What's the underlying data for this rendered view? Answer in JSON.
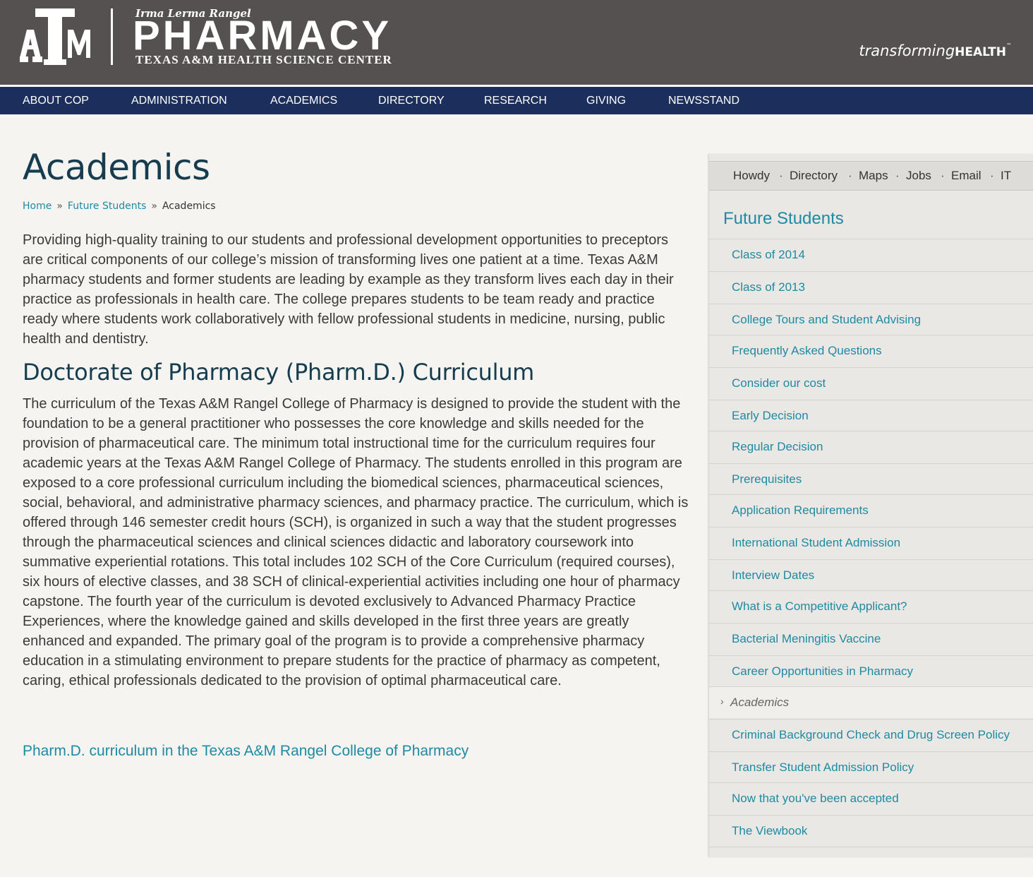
{
  "header": {
    "logo_sub": "Irma Lerma Rangel",
    "logo_main": "PHARMACY",
    "logo_center": "TEXAS A&M HEALTH SCIENCE CENTER",
    "logo_mark": "ATM",
    "tagline_part1": "transforming",
    "tagline_part2": "HEALTH",
    "tagline_tm": "™"
  },
  "nav": {
    "items": [
      "ABOUT COP",
      "ADMINISTRATION",
      "ACADEMICS",
      "DIRECTORY",
      "RESEARCH",
      "GIVING",
      "NEWSSTAND"
    ]
  },
  "main": {
    "title": "Academics",
    "breadcrumb": {
      "home": "Home",
      "sep": "»",
      "future": "Future Students",
      "current": "Academics"
    },
    "intro": "Providing high-quality training to our students and professional development opportunities to preceptors are critical components of our college’s mission of transforming lives one patient at a time. Texas A&M pharmacy students and former students are leading by example as they transform lives each day in their practice as professionals in health care. The college prepares students to be team ready and practice ready where students work collaboratively with fellow professional students in medicine, nursing, public health and dentistry.",
    "section_heading": "Doctorate of Pharmacy (Pharm.D.) Curriculum",
    "curriculum": "The curriculum of the Texas A&M Rangel College of Pharmacy is designed to provide the student with the foundation to be a general practitioner who possesses the core knowledge and skills needed for the provision of pharmaceutical care. The minimum total instructional time for the curriculum requires four academic years at the Texas A&M Rangel College of Pharmacy. The students enrolled in this program are exposed to a core professional curriculum including the biomedical sciences, pharmaceutical sciences, social, behavioral, and administrative pharmacy sciences, and pharmacy practice. The curriculum, which is offered through 146 semester credit hours (SCH), is organized in such a way that the student progresses through the pharmaceutical sciences and clinical sciences didactic and laboratory coursework into summative experiential rotations. This total includes 102 SCH of the Core Curriculum (required courses), six hours of elective classes, and 38 SCH of clinical-experiential activities including one hour of pharmacy capstone. The fourth year of the curriculum is devoted exclusively to Advanced Pharmacy Practice Experiences, where the knowledge gained and skills developed in the first three years are greatly enhanced and expanded. The primary goal of the program is to provide a comprehensive pharmacy education in a stimulating environment to prepare students for the practice of pharmacy as competent, caring, ethical professionals dedicated to the provision of optimal pharmaceutical care.",
    "pharmd_link": "Pharm.D. curriculum in the Texas A&M Rangel College of Pharmacy"
  },
  "sidebar": {
    "utility": {
      "links": [
        "Howdy",
        "Directory",
        "Maps",
        "Jobs",
        "Email",
        "IT"
      ],
      "sep": "·"
    },
    "title": "Future Students",
    "chevron": "›",
    "items": [
      {
        "label": "Class of 2014",
        "active": false
      },
      {
        "label": "Class of 2013",
        "active": false
      },
      {
        "label": "College Tours and Student Advising",
        "active": false
      },
      {
        "label": "Frequently Asked Questions",
        "active": false
      },
      {
        "label": "Consider our cost",
        "active": false
      },
      {
        "label": "Early Decision",
        "active": false
      },
      {
        "label": "Regular Decision",
        "active": false
      },
      {
        "label": "Prerequisites",
        "active": false
      },
      {
        "label": "Application Requirements",
        "active": false
      },
      {
        "label": "International Student Admission",
        "active": false
      },
      {
        "label": "Interview Dates",
        "active": false
      },
      {
        "label": "What is a Competitive Applicant?",
        "active": false
      },
      {
        "label": "Bacterial Meningitis Vaccine",
        "active": false
      },
      {
        "label": "Career Opportunities in Pharmacy",
        "active": false
      },
      {
        "label": "Academics",
        "active": true
      },
      {
        "label": "Criminal Background Check and Drug Screen Policy",
        "active": false
      },
      {
        "label": "Transfer Student Admission Policy",
        "active": false
      },
      {
        "label": "Now that you've been accepted",
        "active": false
      },
      {
        "label": "The Viewbook",
        "active": false
      }
    ]
  },
  "colors": {
    "header_bg": "#555150",
    "nav_bg": "#1c2f5c",
    "link": "#1f8aa3",
    "heading": "#153d4f"
  }
}
